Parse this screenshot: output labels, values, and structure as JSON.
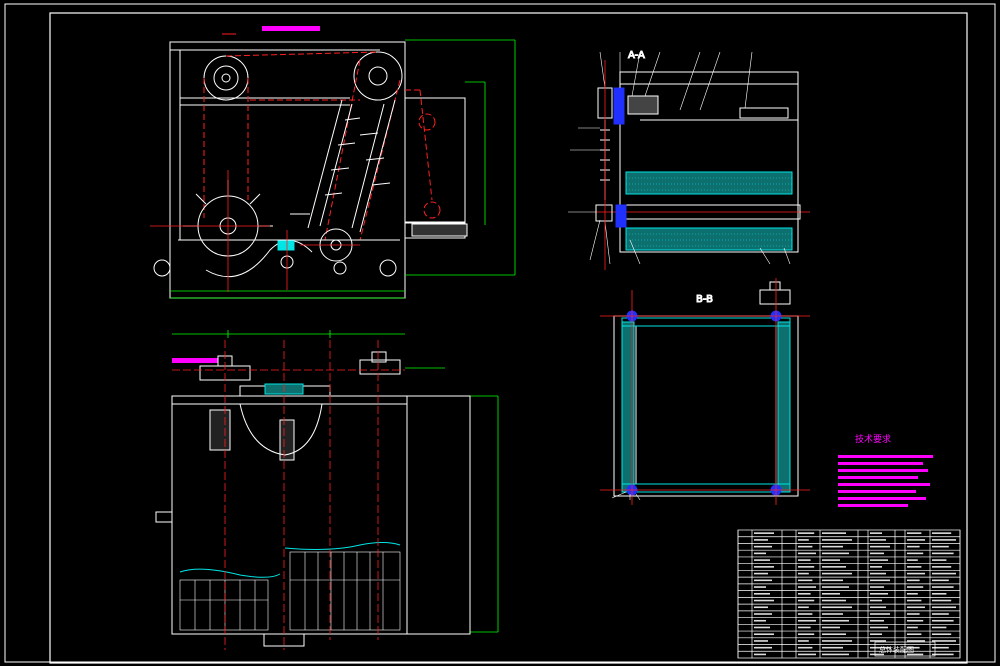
{
  "colors": {
    "background": "#000000",
    "frame": "#ffffff",
    "outline": "#ffffff",
    "centerline": "#ff2020",
    "dimension": "#00ff00",
    "section_label": "#ff00ff",
    "hatch": "#00e5e5",
    "blue": "#2030ff",
    "yellow": "#ffff00"
  },
  "labels": {
    "section_a": "A-A",
    "section_b": "B-B",
    "tech_req_title": "技术要求",
    "title_block_name": "总体装配图"
  },
  "views": {
    "front_view": "front elevation with drum, chain conveyor and scraper",
    "side_section": "section A-A with rollers and sprocket",
    "plan_view": "lower plan view with tank and screen",
    "section_b": "section B-B frame square"
  }
}
